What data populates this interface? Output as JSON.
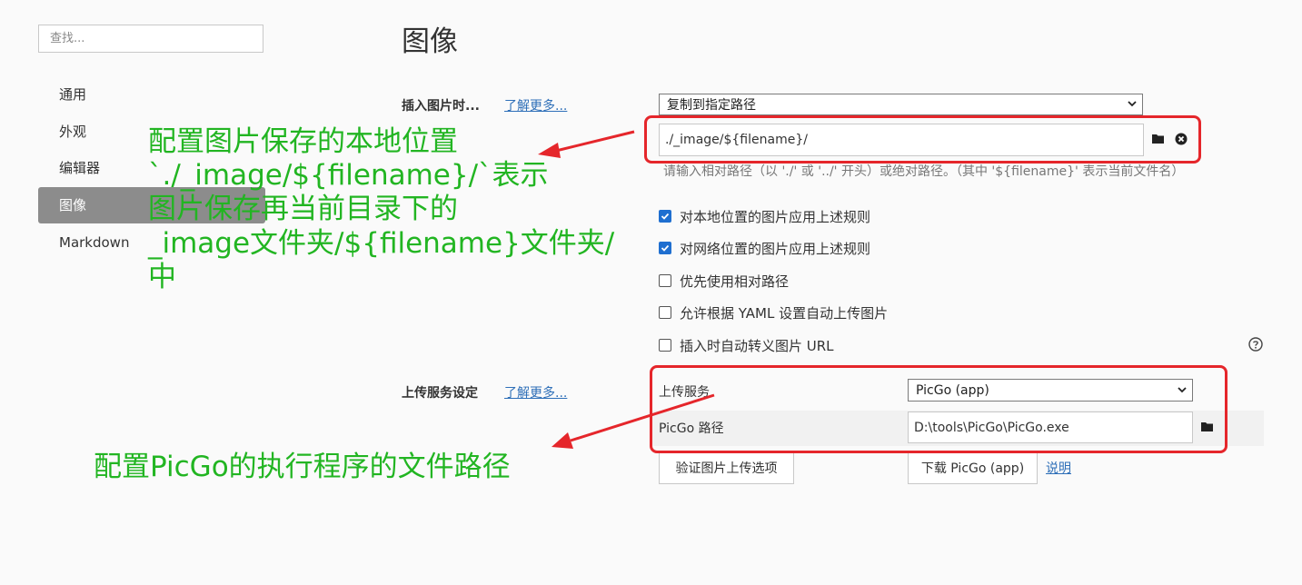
{
  "sidebar": {
    "search_placeholder": "查找...",
    "items": [
      {
        "label": "通用"
      },
      {
        "label": "外观"
      },
      {
        "label": "编辑器"
      },
      {
        "label": "图像",
        "active": true
      },
      {
        "label": "Markdown"
      }
    ]
  },
  "main": {
    "title": "图像",
    "insert": {
      "label": "插入图片时...",
      "learn_more": "了解更多...",
      "select_value": "复制到指定路径",
      "path_value": "./_image/${filename}/",
      "hint": "请输入相对路径（以 './' 或 '../' 开头）或绝对路径。（其中 '${filename}' 表示当前文件名）"
    },
    "checkboxes": [
      {
        "label": "对本地位置的图片应用上述规则",
        "checked": true
      },
      {
        "label": "对网络位置的图片应用上述规则",
        "checked": true
      },
      {
        "label": "优先使用相对路径",
        "checked": false
      },
      {
        "label": "允许根据 YAML 设置自动上传图片",
        "checked": false
      },
      {
        "label": "插入时自动转义图片 URL",
        "checked": false
      }
    ],
    "upload": {
      "label": "上传服务设定",
      "learn_more": "了解更多...",
      "service_label": "上传服务",
      "service_value": "PicGo (app)",
      "path_label": "PicGo 路径",
      "path_value": "D:\\tools\\PicGo\\PicGo.exe",
      "verify_button": "验证图片上传选项",
      "download_button": "下载 PicGo (app)",
      "explain_link": "说明"
    }
  },
  "annotations": {
    "image_path_note": [
      "配置图片保存的本地位置",
      "`./_image/${filename}/`表示",
      "图片保存再当前目录下的",
      "_image文件夹/${filename}文件夹/",
      "中"
    ],
    "picgo_note": "配置PicGo的执行程序的文件路径",
    "color": "#22b522",
    "box_color": "#e5262b"
  }
}
